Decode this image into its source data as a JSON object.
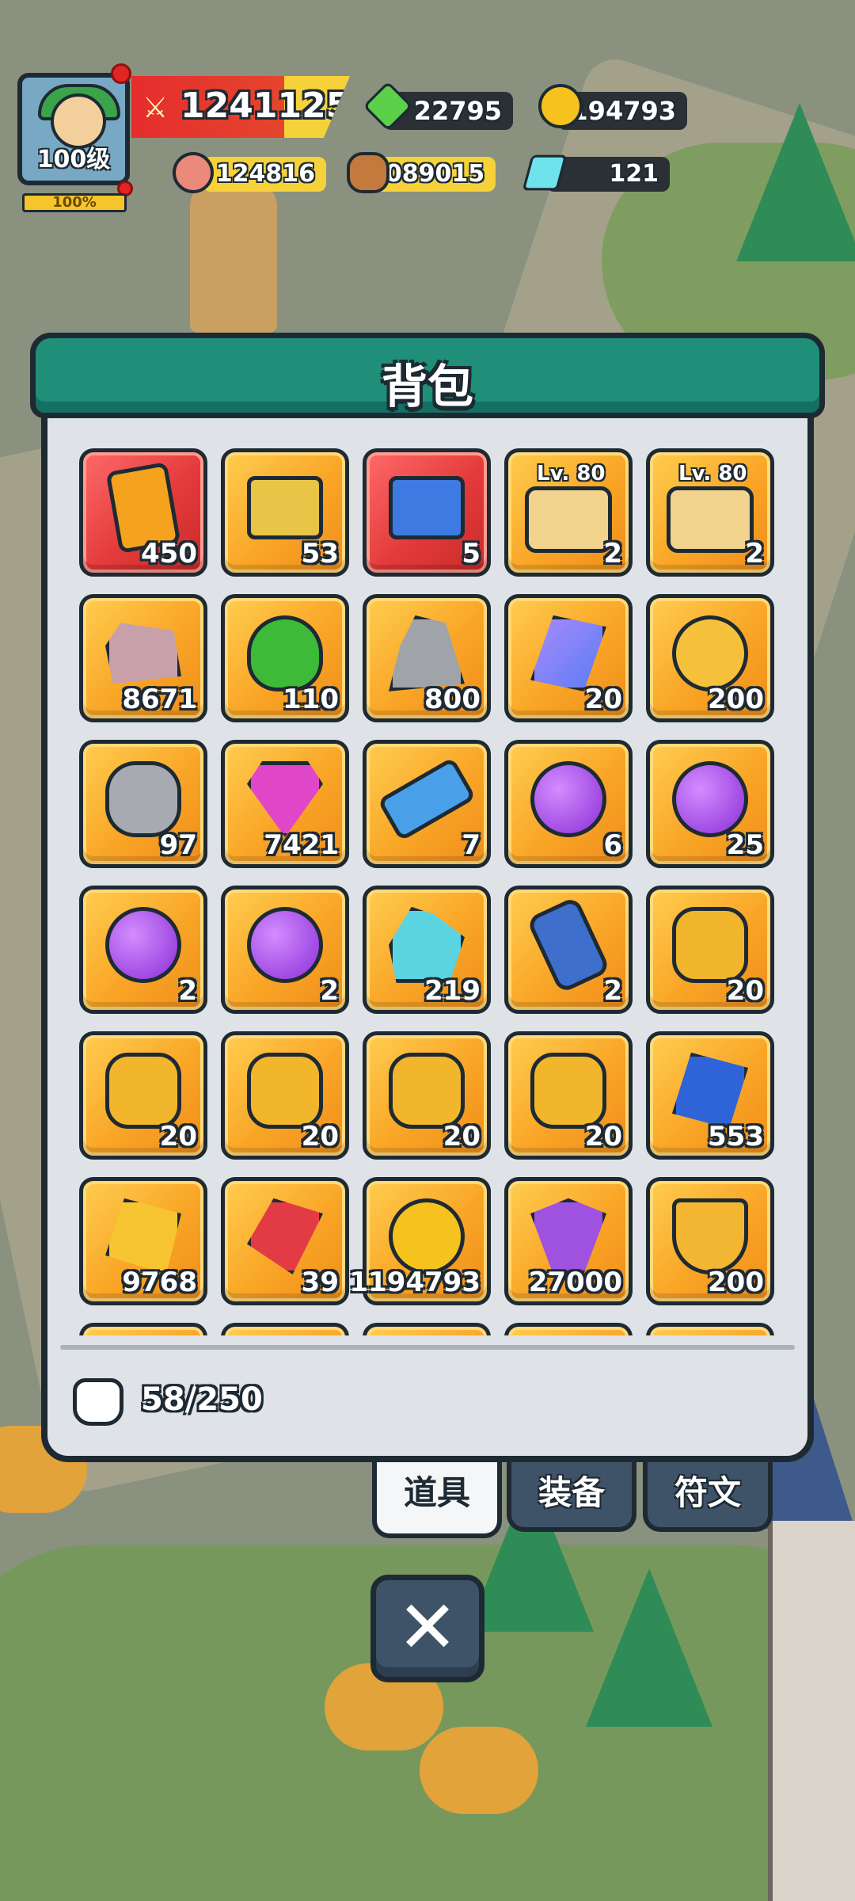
{
  "player": {
    "level_label": "100级",
    "exp_percent_label": "100%",
    "power": "1241125"
  },
  "resources": {
    "green_gem": "22795",
    "gold": "194793",
    "meat": "124816",
    "wood": "1089015",
    "diamond": "121"
  },
  "backpack": {
    "title": "背包",
    "items": [
      {
        "icon": "card-icon",
        "count": "450",
        "bg": "red"
      },
      {
        "icon": "treasure-chest-icon",
        "count": "53",
        "bg": "orange"
      },
      {
        "icon": "royal-chest-icon",
        "count": "5",
        "bg": "red"
      },
      {
        "icon": "scroll-icon",
        "count": "2",
        "bg": "orange",
        "level": "Lv. 80"
      },
      {
        "icon": "scroll-helmet-icon",
        "count": "2",
        "bg": "orange",
        "level": "Lv. 80"
      },
      {
        "icon": "pink-ore-icon",
        "count": "8671",
        "bg": "orange"
      },
      {
        "icon": "clover-icon",
        "count": "110",
        "bg": "orange"
      },
      {
        "icon": "stone-icon",
        "count": "800",
        "bg": "orange"
      },
      {
        "icon": "blue-crystal-icon",
        "count": "20",
        "bg": "orange"
      },
      {
        "icon": "winged-badge-icon",
        "count": "200",
        "bg": "orange"
      },
      {
        "icon": "rune-stone-icon",
        "count": "97",
        "bg": "orange"
      },
      {
        "icon": "pink-gem-icon",
        "count": "7421",
        "bg": "orange"
      },
      {
        "icon": "ticket-icon",
        "count": "7",
        "bg": "orange"
      },
      {
        "icon": "sword-orb-icon",
        "count": "6",
        "bg": "orange"
      },
      {
        "icon": "helmet-orb-icon",
        "count": "25",
        "bg": "orange"
      },
      {
        "icon": "armor-orb-icon",
        "count": "2",
        "bg": "orange"
      },
      {
        "icon": "boots-orb-icon",
        "count": "2",
        "bg": "orange"
      },
      {
        "icon": "teal-crystal-icon",
        "count": "219",
        "bg": "orange"
      },
      {
        "icon": "tag-icon",
        "count": "2",
        "bg": "orange"
      },
      {
        "icon": "hat-medal-icon",
        "count": "20",
        "bg": "orange"
      },
      {
        "icon": "sword-medal-icon",
        "count": "20",
        "bg": "orange"
      },
      {
        "icon": "bow-medal-icon",
        "count": "20",
        "bg": "orange"
      },
      {
        "icon": "shield-medal-icon",
        "count": "20",
        "bg": "orange"
      },
      {
        "icon": "arrow-medal-icon",
        "count": "20",
        "bg": "orange"
      },
      {
        "icon": "sapphire-icon",
        "count": "553",
        "bg": "orange"
      },
      {
        "icon": "gold-ore-icon",
        "count": "9768",
        "bg": "orange"
      },
      {
        "icon": "ruby-icon",
        "count": "39",
        "bg": "orange"
      },
      {
        "icon": "gold-coin-icon",
        "count": "1194793",
        "bg": "orange"
      },
      {
        "icon": "amethyst-icon",
        "count": "27000",
        "bg": "orange"
      },
      {
        "icon": "anchor-icon",
        "count": "200",
        "bg": "orange"
      }
    ],
    "capacity": "58/250"
  },
  "tabs": [
    {
      "label": "道具",
      "active": true
    },
    {
      "label": "装备",
      "active": false
    },
    {
      "label": "符文",
      "active": false
    }
  ]
}
